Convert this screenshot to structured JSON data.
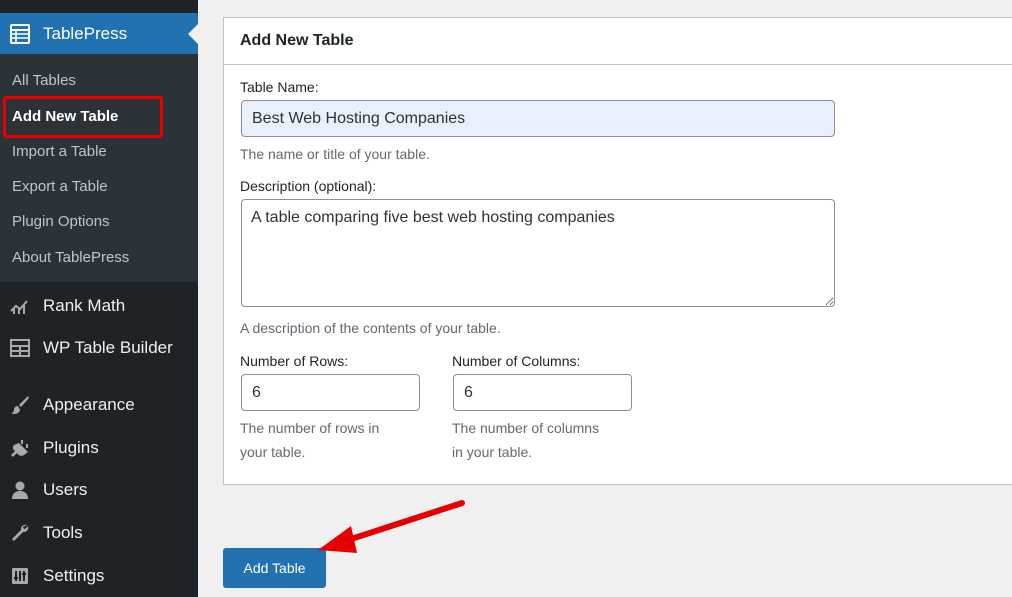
{
  "sidebar": {
    "current": {
      "label": "TablePress"
    },
    "submenu": [
      {
        "label": "All Tables"
      },
      {
        "label": "Add New Table"
      },
      {
        "label": "Import a Table"
      },
      {
        "label": "Export a Table"
      },
      {
        "label": "Plugin Options"
      },
      {
        "label": "About TablePress"
      }
    ],
    "menu": [
      {
        "label": "Rank Math",
        "icon": "chart-icon"
      },
      {
        "label": "WP Table Builder",
        "icon": "table-grid-icon"
      },
      {
        "label": "Appearance",
        "icon": "paintbrush-icon"
      },
      {
        "label": "Plugins",
        "icon": "plug-icon"
      },
      {
        "label": "Users",
        "icon": "user-icon"
      },
      {
        "label": "Tools",
        "icon": "wrench-icon"
      },
      {
        "label": "Settings",
        "icon": "settings-icon"
      }
    ]
  },
  "panel": {
    "title": "Add New Table",
    "table_name": {
      "label": "Table Name:",
      "value": "Best Web Hosting Companies",
      "help": "The name or title of your table."
    },
    "description": {
      "label": "Description (optional):",
      "value": "A table comparing five best web hosting companies",
      "help": "A description of the contents of your table."
    },
    "rows": {
      "label": "Number of Rows:",
      "value": "6",
      "help_line1": "The number of rows in",
      "help_line2": "your table."
    },
    "columns": {
      "label": "Number of Columns:",
      "value": "6",
      "help_line1": "The number of columns",
      "help_line2": "in your table."
    }
  },
  "actions": {
    "add_table_label": "Add Table"
  },
  "colors": {
    "accent": "#2271b1",
    "sidebar_bg": "#1d2327",
    "highlight": "#e60000"
  }
}
